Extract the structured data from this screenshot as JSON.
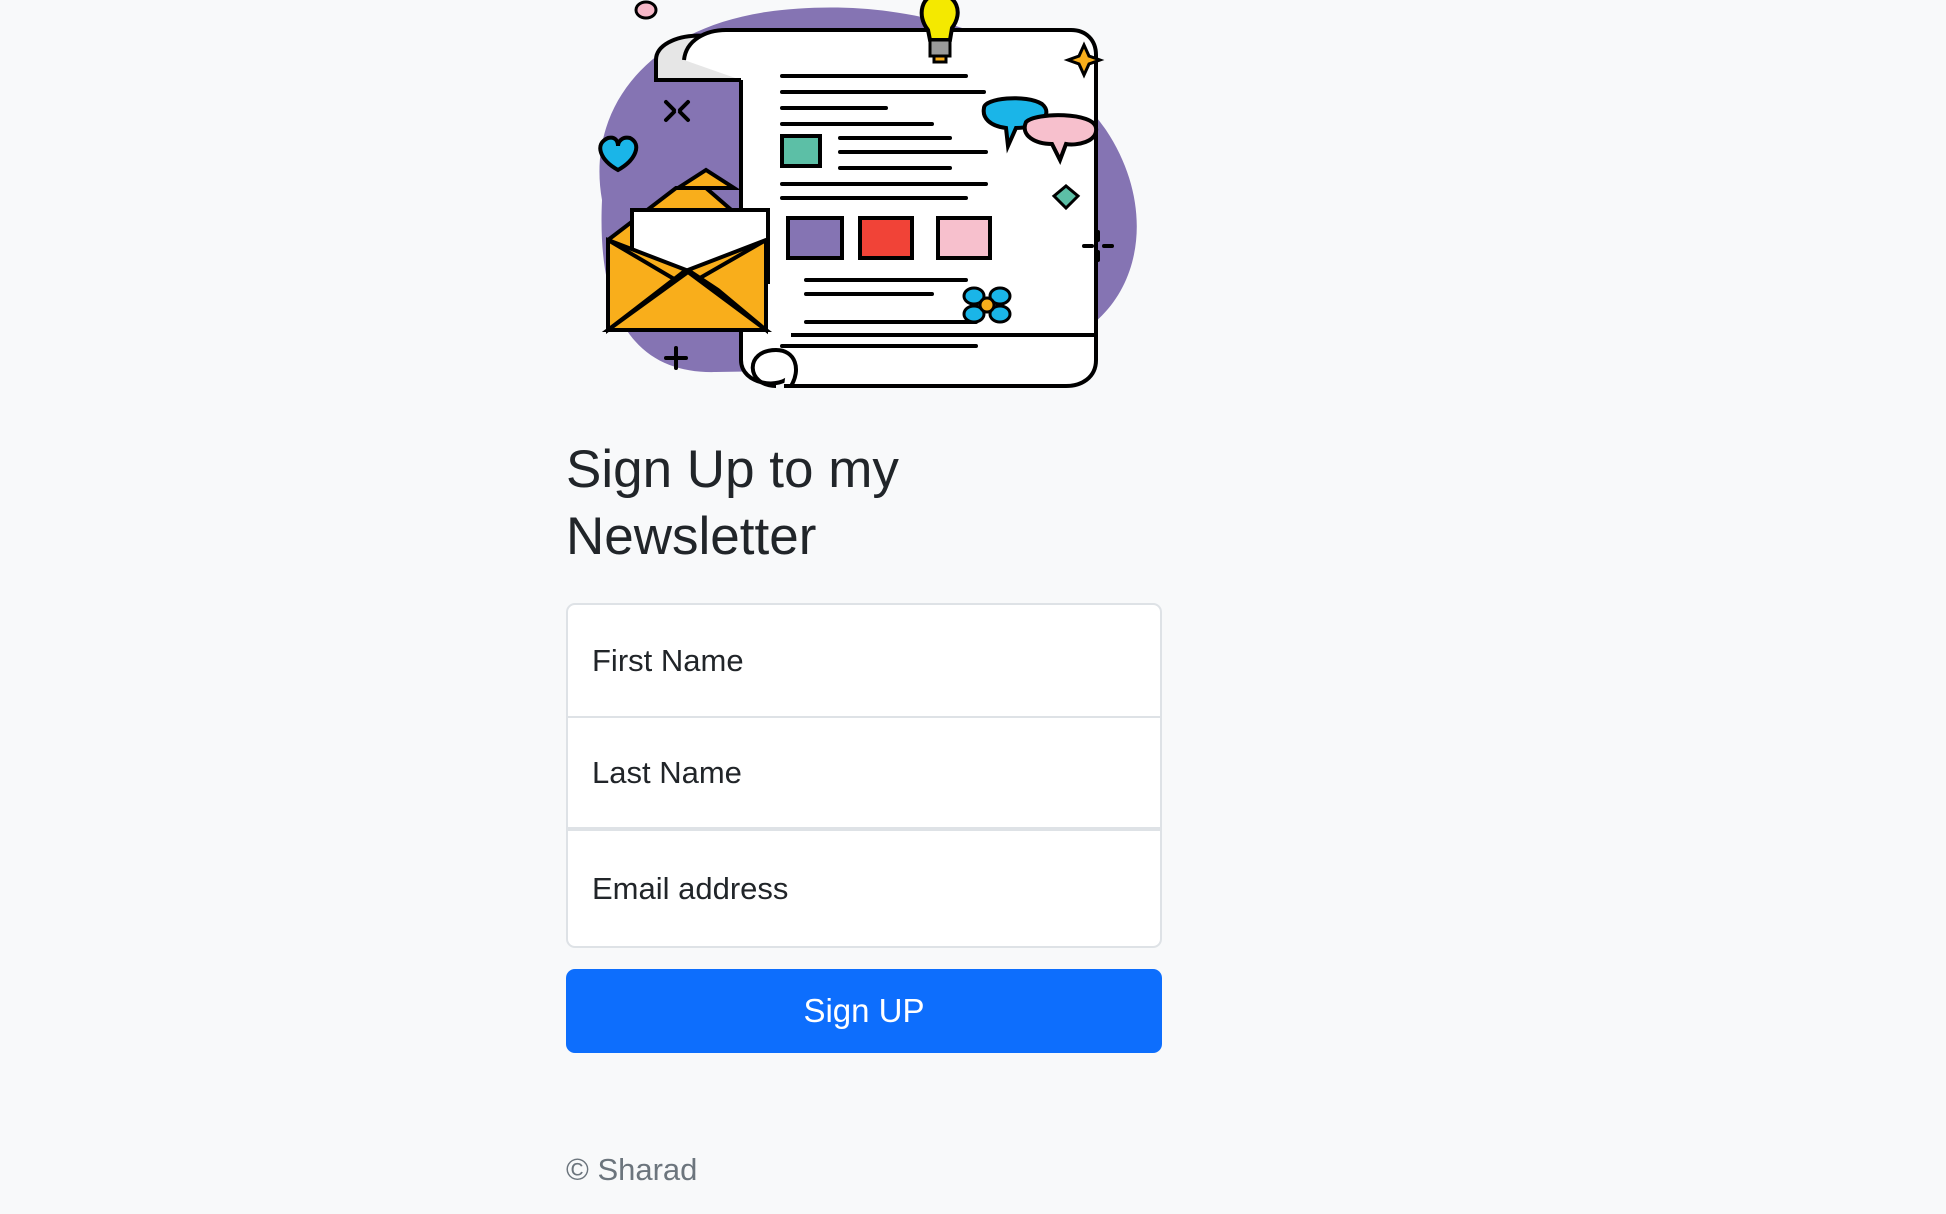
{
  "form": {
    "title": "Sign Up to my Newsletter",
    "first_name_placeholder": "First Name",
    "last_name_placeholder": "Last Name",
    "email_placeholder": "Email address",
    "submit_label": "Sign UP"
  },
  "footer": {
    "copyright": "© Sharad"
  },
  "colors": {
    "background": "#f8f9fa",
    "button": "#0d6efd",
    "blob": "#8574b3",
    "envelope": "#f9ae1b"
  },
  "illustration": {
    "icon": "newsletter-illustration"
  }
}
